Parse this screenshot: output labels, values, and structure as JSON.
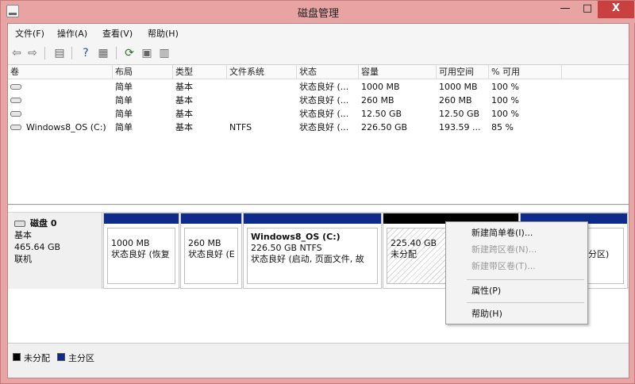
{
  "window": {
    "title": "磁盘管理",
    "minimize": "—",
    "maximize": "□",
    "close": "X"
  },
  "menu": [
    "文件(F)",
    "操作(A)",
    "查看(V)",
    "帮助(H)"
  ],
  "toolbar_icons": [
    "back-arrow-icon",
    "forward-arrow-icon",
    "console-tree-icon",
    "help-icon",
    "properties-icon",
    "refresh-icon",
    "export-icon",
    "disk-settings-icon"
  ],
  "volume_table": {
    "columns": [
      "卷",
      "布局",
      "类型",
      "文件系统",
      "状态",
      "容量",
      "可用空间",
      "% 可用"
    ],
    "rows": [
      [
        "",
        "简单",
        "基本",
        "",
        "状态良好 (...",
        "1000 MB",
        "1000 MB",
        "100 %"
      ],
      [
        "",
        "简单",
        "基本",
        "",
        "状态良好 (...",
        "260 MB",
        "260 MB",
        "100 %"
      ],
      [
        "",
        "简单",
        "基本",
        "",
        "状态良好 (...",
        "12.50 GB",
        "12.50 GB",
        "100 %"
      ],
      [
        "Windows8_OS (C:)",
        "简单",
        "基本",
        "NTFS",
        "状态良好 (...",
        "226.50 GB",
        "193.59 ...",
        "85 %"
      ]
    ]
  },
  "disk": {
    "name": "磁盘 0",
    "type": "基本",
    "size": "465.64 GB",
    "status": "联机",
    "partitions": [
      {
        "name": "",
        "line1": "1000 MB",
        "line2": "状态良好 (恢复"
      },
      {
        "name": "",
        "line1": "260 MB",
        "line2": "状态良好 (E"
      },
      {
        "name": "Windows8_OS  (C:)",
        "line1": "226.50 GB NTFS",
        "line2": "状态良好 (启动, 页面文件, 故"
      },
      {
        "name": "",
        "line1": "225.40 GB",
        "line2": "未分配"
      },
      {
        "name": "",
        "line1": "",
        "line2": "分区)"
      }
    ]
  },
  "legend": [
    {
      "label": "未分配",
      "color": "#000000"
    },
    {
      "label": "主分区",
      "color": "#0e2a8a"
    }
  ],
  "context_menu": [
    {
      "label": "新建简单卷(I)...",
      "enabled": true
    },
    {
      "label": "新建跨区卷(N)...",
      "enabled": false
    },
    {
      "label": "新建带区卷(T)...",
      "enabled": false
    },
    {
      "label": "属性(P)",
      "enabled": true
    },
    {
      "label": "帮助(H)",
      "enabled": true
    }
  ]
}
